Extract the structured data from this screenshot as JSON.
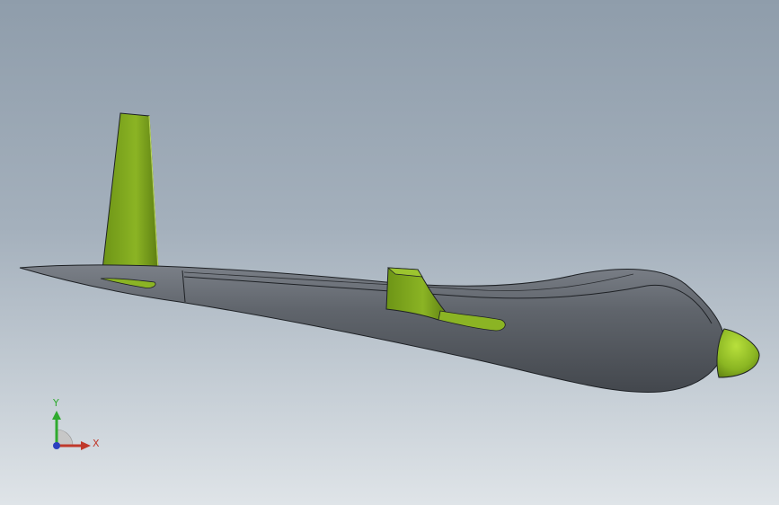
{
  "viewport": {
    "background_top": "#8f9dab",
    "background_bottom": "#dfe4e8"
  },
  "model": {
    "body_color": "#5c6168",
    "part_color": "#7ca21c",
    "edge_color": "#1e2125"
  },
  "triad": {
    "y_label": "Y",
    "x_label": "X",
    "y_color": "#2faa2f",
    "x_color": "#c0392b",
    "z_color": "#2b3fbf"
  }
}
